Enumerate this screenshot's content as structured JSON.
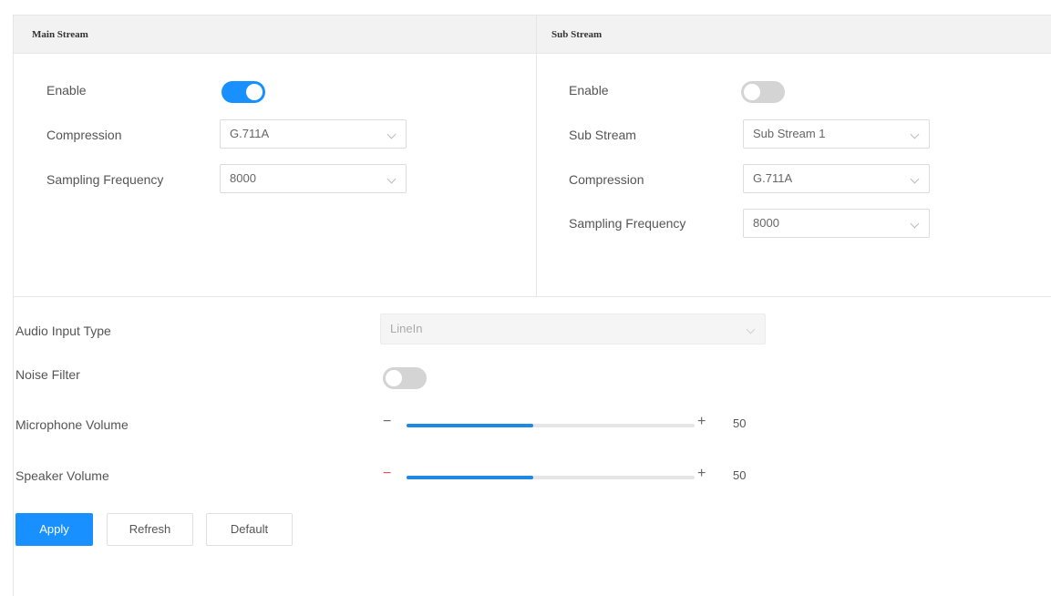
{
  "main_stream": {
    "title": "Main Stream",
    "enable_label": "Enable",
    "enable_on": true,
    "compression_label": "Compression",
    "compression_value": "G.711A",
    "sampling_label": "Sampling Frequency",
    "sampling_value": "8000"
  },
  "sub_stream": {
    "title": "Sub Stream",
    "enable_label": "Enable",
    "enable_on": false,
    "substream_label": "Sub Stream",
    "substream_value": "Sub Stream 1",
    "compression_label": "Compression",
    "compression_value": "G.711A",
    "sampling_label": "Sampling Frequency",
    "sampling_value": "8000"
  },
  "audio": {
    "input_type_label": "Audio Input  Type",
    "input_type_value": "LineIn",
    "noise_filter_label": "Noise Filter",
    "noise_filter_on": false,
    "mic_volume_label": "Microphone Volume",
    "mic_volume": 50,
    "mic_volume_text": "50",
    "speaker_volume_label": "Speaker Volume",
    "speaker_volume": 50,
    "speaker_volume_text": "50",
    "minus": "−",
    "plus": "+"
  },
  "buttons": {
    "apply": "Apply",
    "refresh": "Refresh",
    "default": "Default"
  },
  "colors": {
    "accent": "#1890ff",
    "slider_fill": "#1e88e5",
    "toggle_off": "#d4d4d4"
  }
}
